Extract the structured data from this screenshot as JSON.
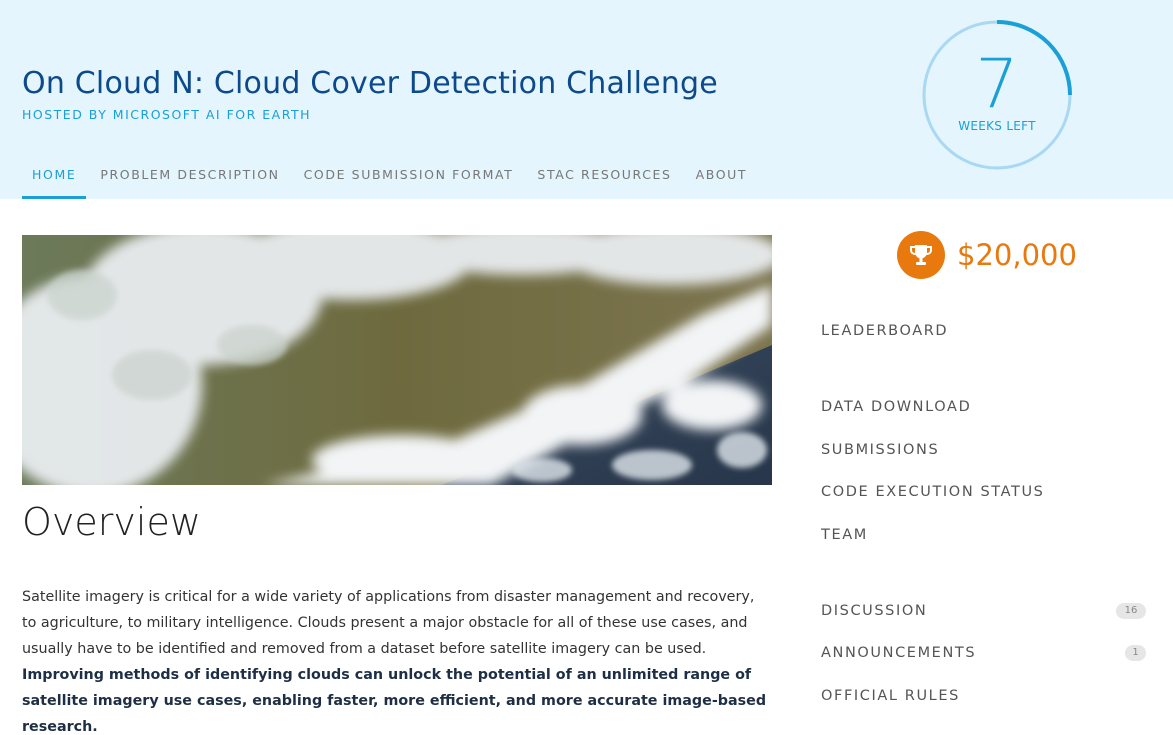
{
  "header": {
    "title": "On Cloud N: Cloud Cover Detection Challenge",
    "host": "HOSTED BY MICROSOFT AI FOR EARTH",
    "tabs": [
      {
        "label": "HOME",
        "active": true
      },
      {
        "label": "PROBLEM DESCRIPTION",
        "active": false
      },
      {
        "label": "CODE SUBMISSION FORMAT",
        "active": false
      },
      {
        "label": "STAC RESOURCES",
        "active": false
      },
      {
        "label": "ABOUT",
        "active": false
      }
    ]
  },
  "timer": {
    "value": "7",
    "label": "WEEKS LEFT",
    "fraction_remaining": 0.25
  },
  "main": {
    "heading": "Overview",
    "intro": "Satellite imagery is critical for a wide variety of applications from disaster management and recovery, to agriculture, to military intelligence. Clouds present a major obstacle for all of these use cases, and usually have to be identified and removed from a dataset before satellite imagery can be used.",
    "intro_bold": "Improving methods of identifying clouds can unlock the potential of an unlimited range of satellite imagery use cases, enabling faster, more efficient, and more accurate image-based research."
  },
  "sidebar": {
    "prize": "$20,000",
    "links": {
      "leaderboard": "LEADERBOARD",
      "data_download": "DATA DOWNLOAD",
      "submissions": "SUBMISSIONS",
      "code_execution_status": "CODE EXECUTION STATUS",
      "team": "TEAM",
      "discussion": "DISCUSSION",
      "announcements": "ANNOUNCEMENTS",
      "official_rules": "OFFICIAL RULES"
    },
    "badges": {
      "discussion": "16",
      "announcements": "1"
    }
  },
  "colors": {
    "header_bg": "#e4f5fd",
    "accent_blue": "#1a9fd6",
    "title_blue": "#0d4a8c",
    "prize_orange": "#e8790e"
  }
}
